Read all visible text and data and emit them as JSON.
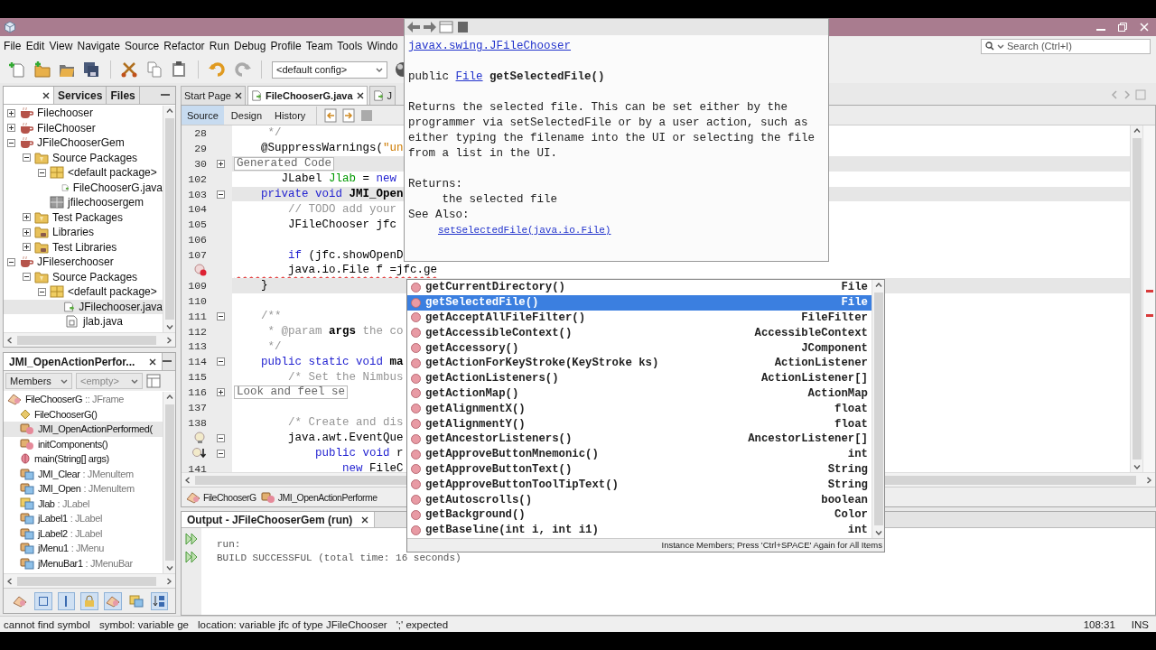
{
  "menu": [
    "File",
    "Edit",
    "View",
    "Navigate",
    "Source",
    "Refactor",
    "Run",
    "Debug",
    "Profile",
    "Team",
    "Tools",
    "Windo"
  ],
  "search": {
    "placeholder": "Search (Ctrl+I)"
  },
  "toolbar": {
    "config": "<default config>"
  },
  "projects_panel": {
    "tabs": [
      {
        "label": "Services",
        "selected": false
      },
      {
        "label": "Files",
        "selected": false
      }
    ],
    "tree": [
      {
        "label": "Filechooser",
        "kind": "project",
        "expanded": false,
        "selected": false
      },
      {
        "label": "FileChooser",
        "kind": "project",
        "expanded": false,
        "selected": false
      },
      {
        "label": "JFileChooserGem",
        "kind": "project",
        "expanded": true,
        "selected": false,
        "children": [
          {
            "label": "Source Packages",
            "kind": "source-folder",
            "expanded": true,
            "selected": false,
            "children": [
              {
                "label": "<default package>",
                "kind": "package",
                "expanded": true,
                "selected": false,
                "children": [
                  {
                    "label": "FileChooserG.java",
                    "kind": "java-file",
                    "selected": false
                  }
                ]
              },
              {
                "label": "jfilechoosergem",
                "kind": "empty-package",
                "selected": false
              }
            ]
          },
          {
            "label": "Test Packages",
            "kind": "source-folder",
            "expanded": false,
            "selected": false
          },
          {
            "label": "Libraries",
            "kind": "library-folder",
            "expanded": false,
            "selected": false
          },
          {
            "label": "Test Libraries",
            "kind": "library-folder",
            "expanded": false,
            "selected": false
          }
        ]
      },
      {
        "label": "JFileserchooser",
        "kind": "project",
        "expanded": true,
        "selected": false,
        "children": [
          {
            "label": "Source Packages",
            "kind": "source-folder",
            "expanded": true,
            "selected": false,
            "children": [
              {
                "label": "<default package>",
                "kind": "package",
                "expanded": true,
                "selected": false,
                "children": [
                  {
                    "label": "JFilechooser.java",
                    "kind": "java-file",
                    "selected": true
                  },
                  {
                    "label": "jlab.java",
                    "kind": "java-class",
                    "selected": false
                  }
                ]
              }
            ]
          }
        ]
      }
    ]
  },
  "navigator": {
    "title": "JMI_OpenActionPerfor...",
    "filter": "Members",
    "scope": "<empty>",
    "root": {
      "label": "FileChooserG",
      "type": ":: JFrame"
    },
    "members": [
      {
        "label": "FileChooserG()",
        "kind": "constructor",
        "selected": false
      },
      {
        "label": "JMI_OpenActionPerformed(",
        "kind": "method",
        "selected": true
      },
      {
        "label": "initComponents()",
        "kind": "method",
        "selected": false
      },
      {
        "label": "main(String[] args)",
        "kind": "static-method",
        "selected": false
      },
      {
        "label": "JMI_Clear",
        "type": ": JMenuItem",
        "kind": "field",
        "selected": false
      },
      {
        "label": "JMI_Open",
        "type": ": JMenuItem",
        "kind": "field",
        "selected": false
      },
      {
        "label": "Jlab",
        "type": ": JLabel",
        "kind": "package-field",
        "selected": false
      },
      {
        "label": "jLabel1",
        "type": ": JLabel",
        "kind": "field",
        "selected": false
      },
      {
        "label": "jLabel2",
        "type": ": JLabel",
        "kind": "field",
        "selected": false
      },
      {
        "label": "jMenu1",
        "type": ": JMenu",
        "kind": "field",
        "selected": false
      },
      {
        "label": "jMenuBar1",
        "type": ": JMenuBar",
        "kind": "field",
        "selected": false
      }
    ]
  },
  "editor": {
    "tabs": [
      {
        "label": "Start Page",
        "selected": false,
        "closable": true
      },
      {
        "label": "FileChooserG.java",
        "selected": true,
        "closable": true
      },
      {
        "label": "J",
        "selected": false,
        "closable": false
      }
    ],
    "views": [
      {
        "label": "Source",
        "selected": true
      },
      {
        "label": "Design",
        "selected": false
      },
      {
        "label": "History",
        "selected": false
      }
    ],
    "lines": [
      {
        "kind": "numbered",
        "number": "28",
        "highlighted": false,
        "segments": [
          {
            "text": "     */",
            "kind": "comment"
          }
        ]
      },
      {
        "kind": "numbered",
        "number": "29",
        "highlighted": false,
        "segments": [
          {
            "text": "    @SuppressWarnings(",
            "kind": "plain"
          },
          {
            "text": "\"un",
            "kind": "string"
          }
        ]
      },
      {
        "kind": "numbered",
        "number": "30",
        "highlighted": true,
        "expanded": false,
        "segments": [
          {
            "text": "    Generated Code",
            "kind": "folded"
          }
        ]
      },
      {
        "kind": "numbered",
        "number": "102",
        "highlighted": false,
        "segments": [
          {
            "text": "       JLabel ",
            "kind": "plain"
          },
          {
            "text": "Jlab",
            "kind": "field"
          },
          {
            "text": " = ",
            "kind": "plain"
          },
          {
            "text": "new",
            "kind": "keyword"
          }
        ]
      },
      {
        "kind": "numbered",
        "number": "103",
        "highlighted": true,
        "expanded": true,
        "segments": [
          {
            "text": "    private void ",
            "kind": "keyword"
          },
          {
            "text": "JMI_Open",
            "kind": "bold"
          }
        ]
      },
      {
        "kind": "numbered",
        "number": "104",
        "highlighted": false,
        "segments": [
          {
            "text": "        // TODO add your",
            "kind": "comment"
          }
        ]
      },
      {
        "kind": "numbered",
        "number": "105",
        "highlighted": false,
        "segments": [
          {
            "text": "        JFileChooser jfc",
            "kind": "plain"
          }
        ]
      },
      {
        "kind": "numbered",
        "number": "106",
        "highlighted": false
      },
      {
        "kind": "numbered",
        "number": "107",
        "highlighted": false,
        "segments": [
          {
            "text": "        if",
            "kind": "keyword"
          },
          {
            "text": " (jfc.showOpenD",
            "kind": "plain"
          }
        ]
      },
      {
        "kind": "error",
        "highlighted": false,
        "segments": [
          {
            "text": "        java.io.File f =jfc.ge",
            "kind": "error"
          }
        ]
      },
      {
        "kind": "numbered",
        "number": "109",
        "highlighted": true,
        "segments": [
          {
            "text": "    }",
            "kind": "plain"
          }
        ]
      },
      {
        "kind": "numbered",
        "number": "110",
        "highlighted": false
      },
      {
        "kind": "numbered",
        "number": "111",
        "highlighted": false,
        "expanded": true,
        "segments": [
          {
            "text": "    /**",
            "kind": "comment"
          }
        ]
      },
      {
        "kind": "numbered",
        "number": "112",
        "highlighted": false,
        "segments": [
          {
            "text": "     * @param ",
            "kind": "comment"
          },
          {
            "text": "args",
            "kind": "bold"
          },
          {
            "text": " the co",
            "kind": "comment"
          }
        ]
      },
      {
        "kind": "numbered",
        "number": "113",
        "highlighted": false,
        "segments": [
          {
            "text": "     */",
            "kind": "comment"
          }
        ]
      },
      {
        "kind": "numbered",
        "number": "114",
        "highlighted": false,
        "expanded": true,
        "segments": [
          {
            "text": "    public static void ",
            "kind": "keyword"
          },
          {
            "text": "ma",
            "kind": "bold"
          }
        ]
      },
      {
        "kind": "numbered",
        "number": "115",
        "highlighted": false,
        "segments": [
          {
            "text": "        /* Set the Nimbus",
            "kind": "comment"
          }
        ]
      },
      {
        "kind": "numbered",
        "number": "116",
        "highlighted": false,
        "expanded": false,
        "segments": [
          {
            "text": "        Look and feel se",
            "kind": "folded"
          }
        ]
      },
      {
        "kind": "numbered",
        "number": "137",
        "highlighted": false
      },
      {
        "kind": "numbered",
        "number": "138",
        "highlighted": false,
        "segments": [
          {
            "text": "        /* Create and dis",
            "kind": "comment"
          }
        ]
      },
      {
        "kind": "hint",
        "highlighted": false,
        "expanded": true,
        "segments": [
          {
            "text": "        java.awt.EventQue",
            "kind": "plain"
          }
        ]
      },
      {
        "kind": "override",
        "highlighted": false,
        "expanded": true,
        "segments": [
          {
            "text": "            public void ",
            "kind": "keyword"
          },
          {
            "text": "r",
            "kind": "plain"
          }
        ]
      },
      {
        "kind": "numbered",
        "number": "141",
        "highlighted": false,
        "segments": [
          {
            "text": "                new",
            "kind": "keyword"
          },
          {
            "text": " FileC",
            "kind": "plain"
          }
        ]
      }
    ],
    "breadcrumb": [
      "FileChooserG",
      "JMI_OpenActionPerforme"
    ]
  },
  "output": {
    "title": "Output - JFileChooserGem (run)",
    "lines": [
      "run:",
      "BUILD SUCCESSFUL (total time: 16 seconds)"
    ]
  },
  "javadoc": {
    "class_link": "javax.swing.JFileChooser",
    "modifier": "public",
    "return_type": "File",
    "method": "getSelectedFile()",
    "description": "Returns the selected file. This can be set either by the programmer via setSelectedFile or by a user action, such as either typing the filename into the UI or selecting the file from a list in the UI.",
    "returns_label": "Returns:",
    "returns": "the selected file",
    "see_also_label": "See Also:",
    "see_also": "setSelectedFile(java.io.File)"
  },
  "completion": {
    "items": [
      {
        "name": "getCurrentDirectory()",
        "type": "File",
        "selected": false
      },
      {
        "name": "getSelectedFile()",
        "type": "File",
        "selected": true
      },
      {
        "name": "getAcceptAllFileFilter()",
        "type": "FileFilter",
        "selected": false
      },
      {
        "name": "getAccessibleContext()",
        "type": "AccessibleContext",
        "selected": false
      },
      {
        "name": "getAccessory()",
        "type": "JComponent",
        "selected": false
      },
      {
        "name": "getActionForKeyStroke(KeyStroke ks)",
        "type": "ActionListener",
        "selected": false
      },
      {
        "name": "getActionListeners()",
        "type": "ActionListener[]",
        "selected": false
      },
      {
        "name": "getActionMap()",
        "type": "ActionMap",
        "selected": false
      },
      {
        "name": "getAlignmentX()",
        "type": "float",
        "selected": false
      },
      {
        "name": "getAlignmentY()",
        "type": "float",
        "selected": false
      },
      {
        "name": "getAncestorListeners()",
        "type": "AncestorListener[]",
        "selected": false
      },
      {
        "name": "getApproveButtonMnemonic()",
        "type": "int",
        "selected": false
      },
      {
        "name": "getApproveButtonText()",
        "type": "String",
        "selected": false
      },
      {
        "name": "getApproveButtonToolTipText()",
        "type": "String",
        "selected": false
      },
      {
        "name": "getAutoscrolls()",
        "type": "boolean",
        "selected": false
      },
      {
        "name": "getBackground()",
        "type": "Color",
        "selected": false
      },
      {
        "name": "getBaseline(int i, int i1)",
        "type": "int",
        "selected": false
      }
    ],
    "footer": "Instance Members; Press 'Ctrl+SPACE' Again for All Items"
  },
  "status": {
    "messages": [
      "cannot find symbol",
      "symbol:  variable ge",
      "location: variable jfc of type JFileChooser",
      "';' expected"
    ],
    "position": "108:31",
    "mode": "INS"
  }
}
